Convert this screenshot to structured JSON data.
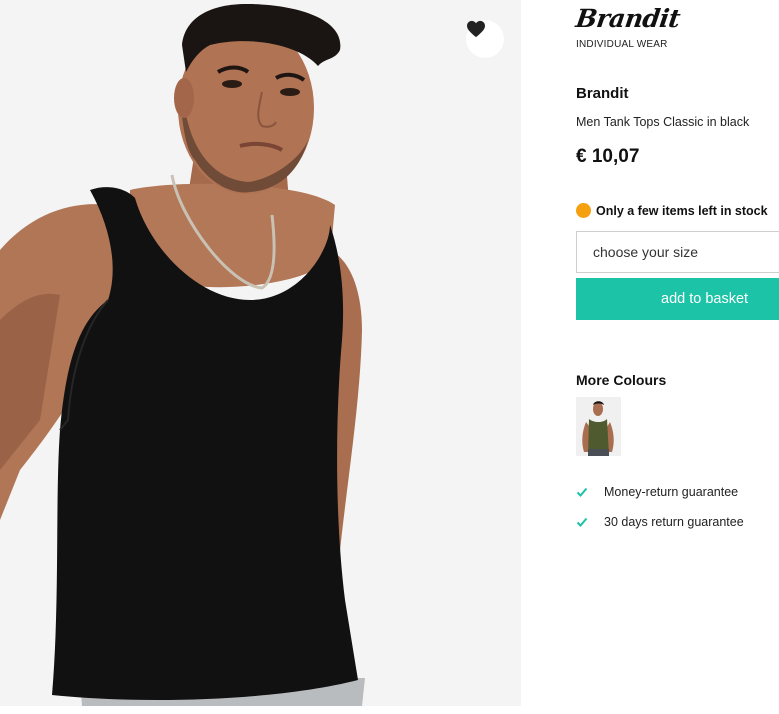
{
  "product": {
    "brand_logo": {
      "script": "Brandit",
      "sub": "INDIVIDUAL WEAR"
    },
    "brand": "Brandit",
    "name": "Men Tank Tops Classic in black",
    "price": "€ 10,07",
    "stock": {
      "text": "Only a few items left in stock",
      "color": "#f5a00f"
    },
    "size_select": {
      "placeholder": "choose your size"
    },
    "add_to_basket": "add to basket",
    "more_colours": {
      "title": "More Colours",
      "swatches": [
        "olive"
      ]
    },
    "guarantees": [
      "Money-return guarantee",
      "30 days return guarantee"
    ]
  },
  "icons": {
    "wishlist": "heart-icon",
    "check": "check-icon"
  },
  "colors": {
    "accent": "#1cc3a6",
    "stock_dot": "#f5a00f",
    "text": "#111111"
  }
}
